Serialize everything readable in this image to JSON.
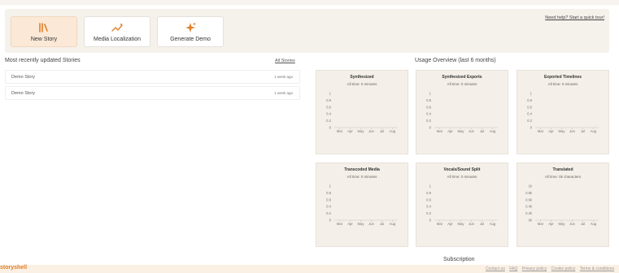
{
  "actions": [
    {
      "label": "New Story",
      "icon": "book-icon"
    },
    {
      "label": "Media Localization",
      "icon": "sparkle-line-icon"
    },
    {
      "label": "Generate Demo",
      "icon": "sparkles-icon"
    }
  ],
  "help_link": "Need help? Start a quick tour!",
  "recent": {
    "title": "Most recently updated Stories",
    "all_link": "All Stories",
    "items": [
      {
        "name": "Demo Story",
        "time": "1 week ago"
      },
      {
        "name": "Demo Story",
        "time": "1 week ago"
      }
    ]
  },
  "usage": {
    "title": "Usage Overview (last 6 months)",
    "cards": [
      {
        "title": "Synthesized",
        "subtitle": "All time: 0 minutes",
        "yticks": [
          "1",
          "0.8",
          "0.6",
          "0.4",
          "0.2",
          "0"
        ]
      },
      {
        "title": "Synthesized Exports",
        "subtitle": "All time: 0 minutes",
        "yticks": [
          "1",
          "0.8",
          "0.6",
          "0.4",
          "0.2",
          "0"
        ]
      },
      {
        "title": "Exported Timelines",
        "subtitle": "All time: 0 minutes",
        "yticks": [
          "1",
          "0.8",
          "0.6",
          "0.4",
          "0.2",
          "0"
        ]
      },
      {
        "title": "Transcoded Media",
        "subtitle": "All time: 0 minutes",
        "yticks": [
          "1",
          "0.8",
          "0.6",
          "0.4",
          "0.2",
          "0"
        ]
      },
      {
        "title": "Vocals/Sound Split",
        "subtitle": "All time: 0 minutes",
        "yticks": [
          "1",
          "0.8",
          "0.6",
          "0.4",
          "0.2",
          "0"
        ]
      },
      {
        "title": "Translated",
        "subtitle": "All time: 0k characters",
        "yticks": [
          "1k",
          "0.8k",
          "0.6k",
          "0.4k",
          "0.2k",
          "0k"
        ]
      }
    ],
    "months": [
      "Mar",
      "Apr",
      "May",
      "Jun",
      "Jul",
      "Aug"
    ]
  },
  "subscription_title": "Subscription",
  "footer": {
    "logo": "storyshell",
    "links": [
      "Contact us",
      "FAQ",
      "Privacy policy",
      "Cookie policy",
      "Terms & conditions"
    ]
  },
  "colors": {
    "accent": "#e07f2a",
    "card_bg": "#f4efe8",
    "primary_card": "#fbe8d6"
  }
}
